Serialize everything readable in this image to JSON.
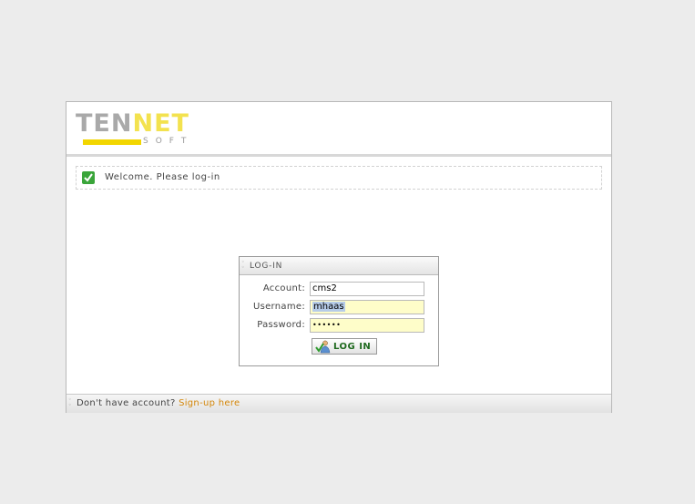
{
  "header": {
    "logo": {
      "part1": "TEN",
      "part2": "NET",
      "sub": "SOFT"
    }
  },
  "welcome": {
    "message": "Welcome. Please log-in"
  },
  "login": {
    "title": "LOG-IN",
    "account_label": "Account:",
    "account_value": "cms2",
    "username_label": "Username:",
    "username_value": "mhaas",
    "password_label": "Password:",
    "password_value": "••••••",
    "button_label": "LOG IN"
  },
  "footer": {
    "prompt": "Don't have account?",
    "signup_link": "Sign-up here"
  },
  "colors": {
    "signup_link": "#d4870a",
    "field_highlight": "#fefdc9",
    "button_text": "#1f6a1f"
  }
}
